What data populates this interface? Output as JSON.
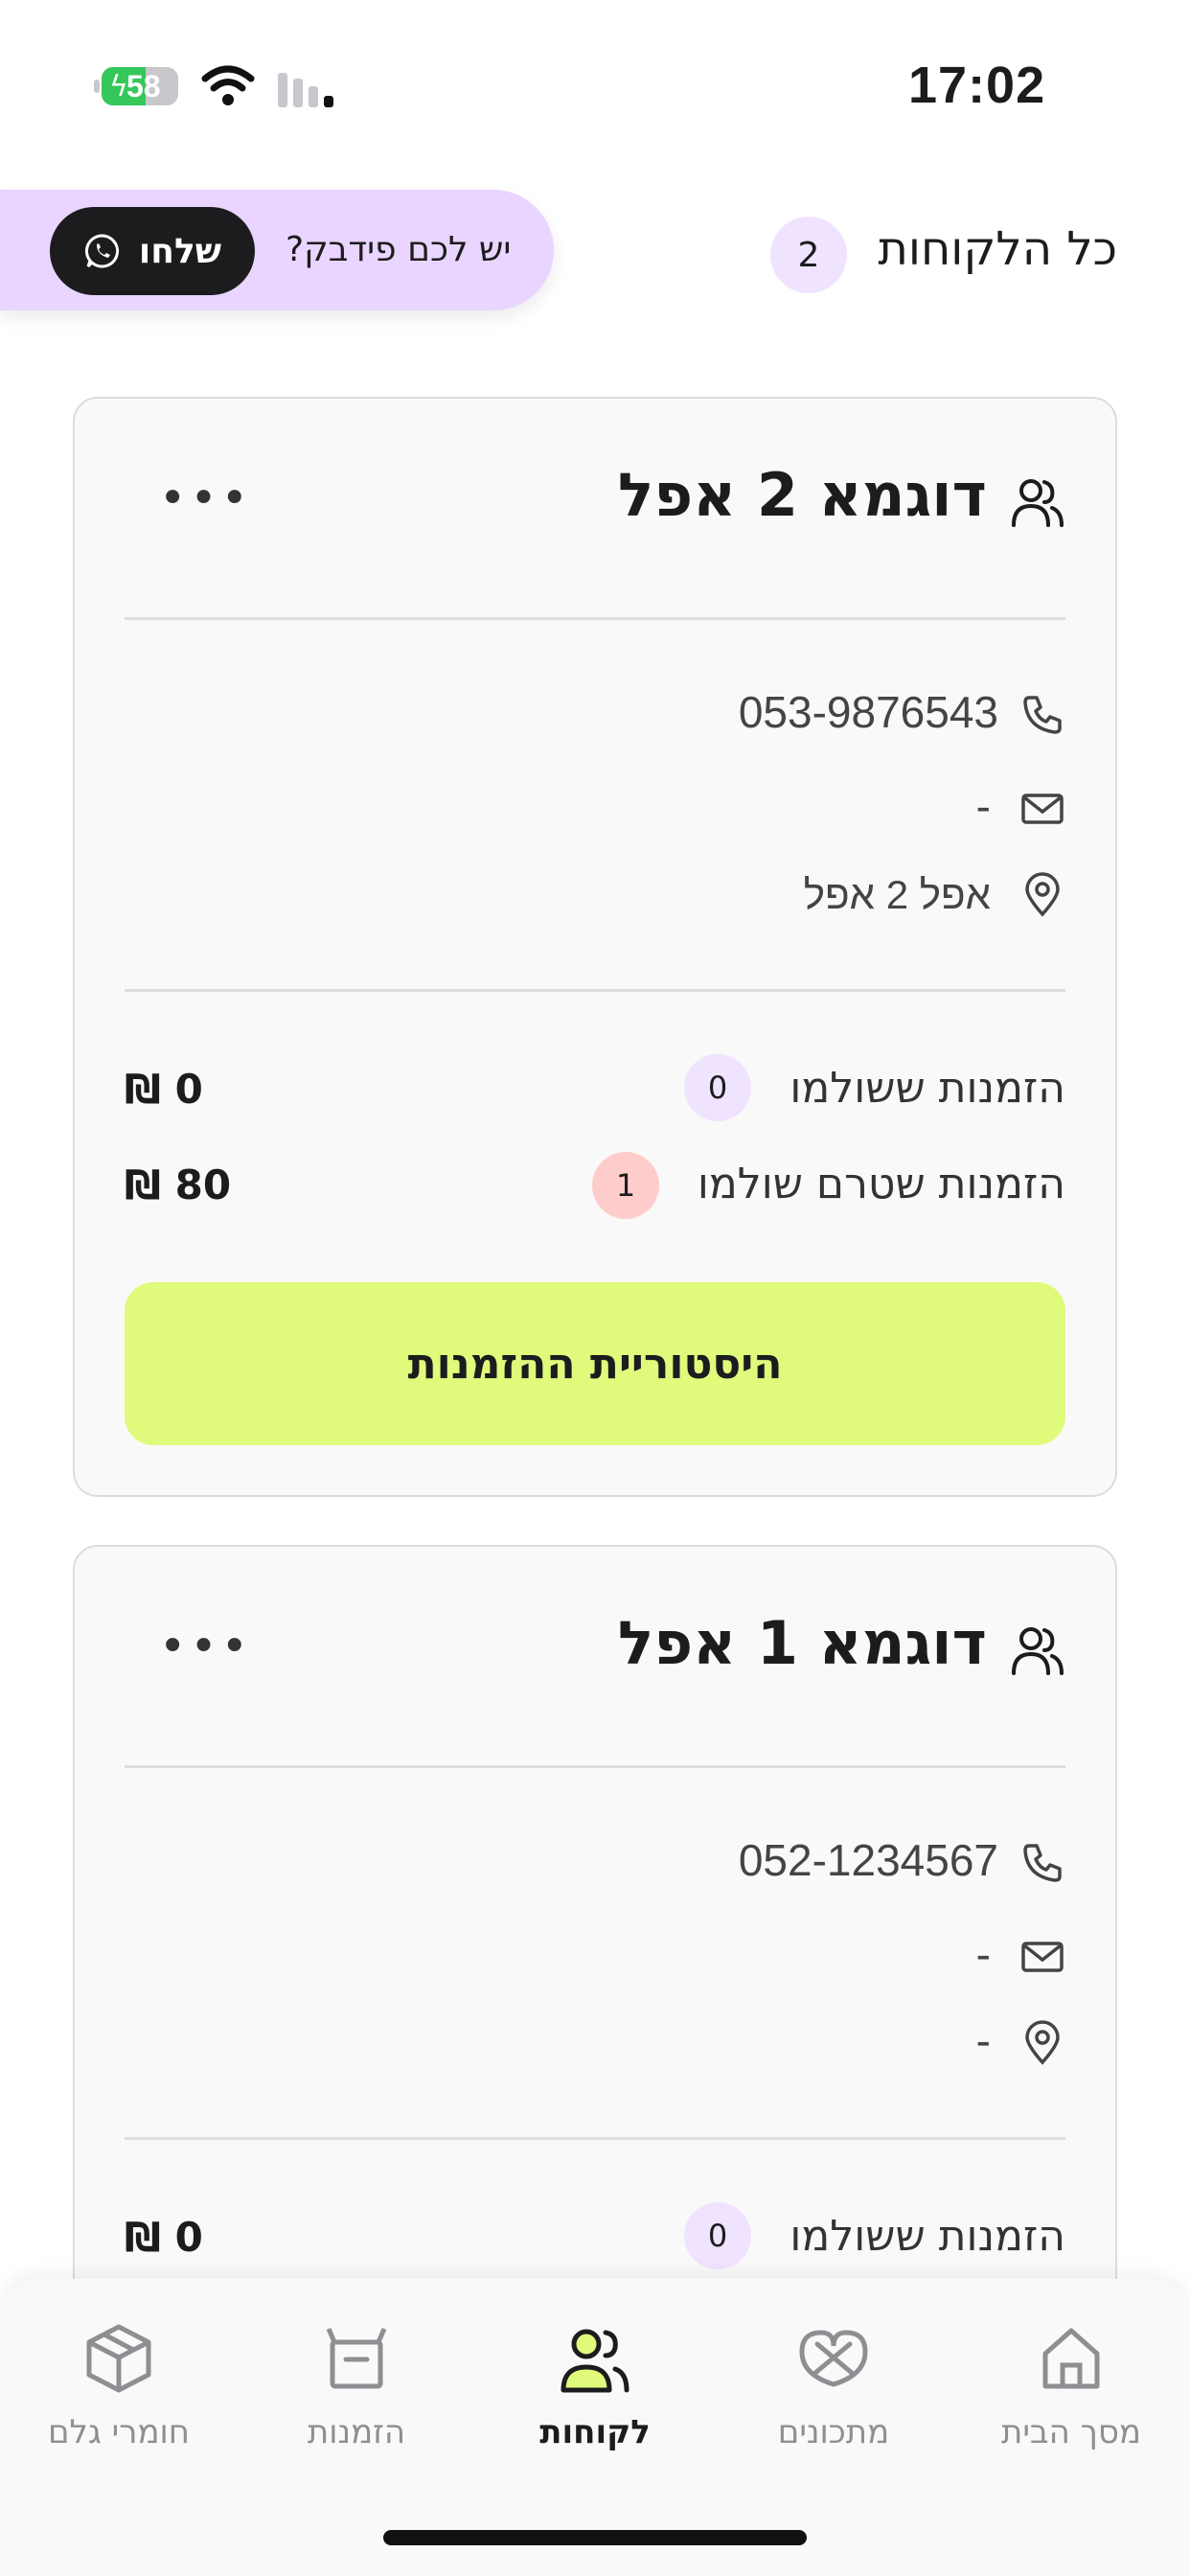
{
  "status_bar": {
    "time": "17:02",
    "battery_level": 58,
    "battery_charging": true
  },
  "header": {
    "title": "כל הלקוחות",
    "count": "2"
  },
  "feedback": {
    "prompt": "יש לכם פידבק?",
    "button_label": "שלחו"
  },
  "customers": [
    {
      "name": "דוגמא 2 אפל",
      "phone": "053-9876543",
      "email": "-",
      "address": "אפל 2 אפל",
      "paid_label": "הזמנות ששולמו",
      "paid_count": "0",
      "paid_amount": "0 ₪",
      "unpaid_label": "הזמנות שטרם שולמו",
      "unpaid_count": "1",
      "unpaid_amount": "80 ₪",
      "history_button": "היסטוריית ההזמנות"
    },
    {
      "name": "דוגמא 1 אפל",
      "phone": "052-1234567",
      "email": "-",
      "address": "-",
      "paid_label": "הזמנות ששולמו",
      "paid_count": "0",
      "paid_amount": "0 ₪"
    }
  ],
  "tabs": [
    {
      "label": "מסך הבית",
      "icon": "home-icon",
      "active": false
    },
    {
      "label": "מתכונים",
      "icon": "pretzel-icon",
      "active": false
    },
    {
      "label": "לקוחות",
      "icon": "users-icon",
      "active": true
    },
    {
      "label": "הזמנות",
      "icon": "box-icon",
      "active": false
    },
    {
      "label": "חומרי גלם",
      "icon": "package-icon",
      "active": false
    }
  ],
  "colors": {
    "accent_lime": "#e0fa7b",
    "lavender": "#e9d5ff",
    "paid_badge": "#efe3ff",
    "unpaid_badge": "#ffcccc",
    "dark": "#1c1c1e"
  }
}
